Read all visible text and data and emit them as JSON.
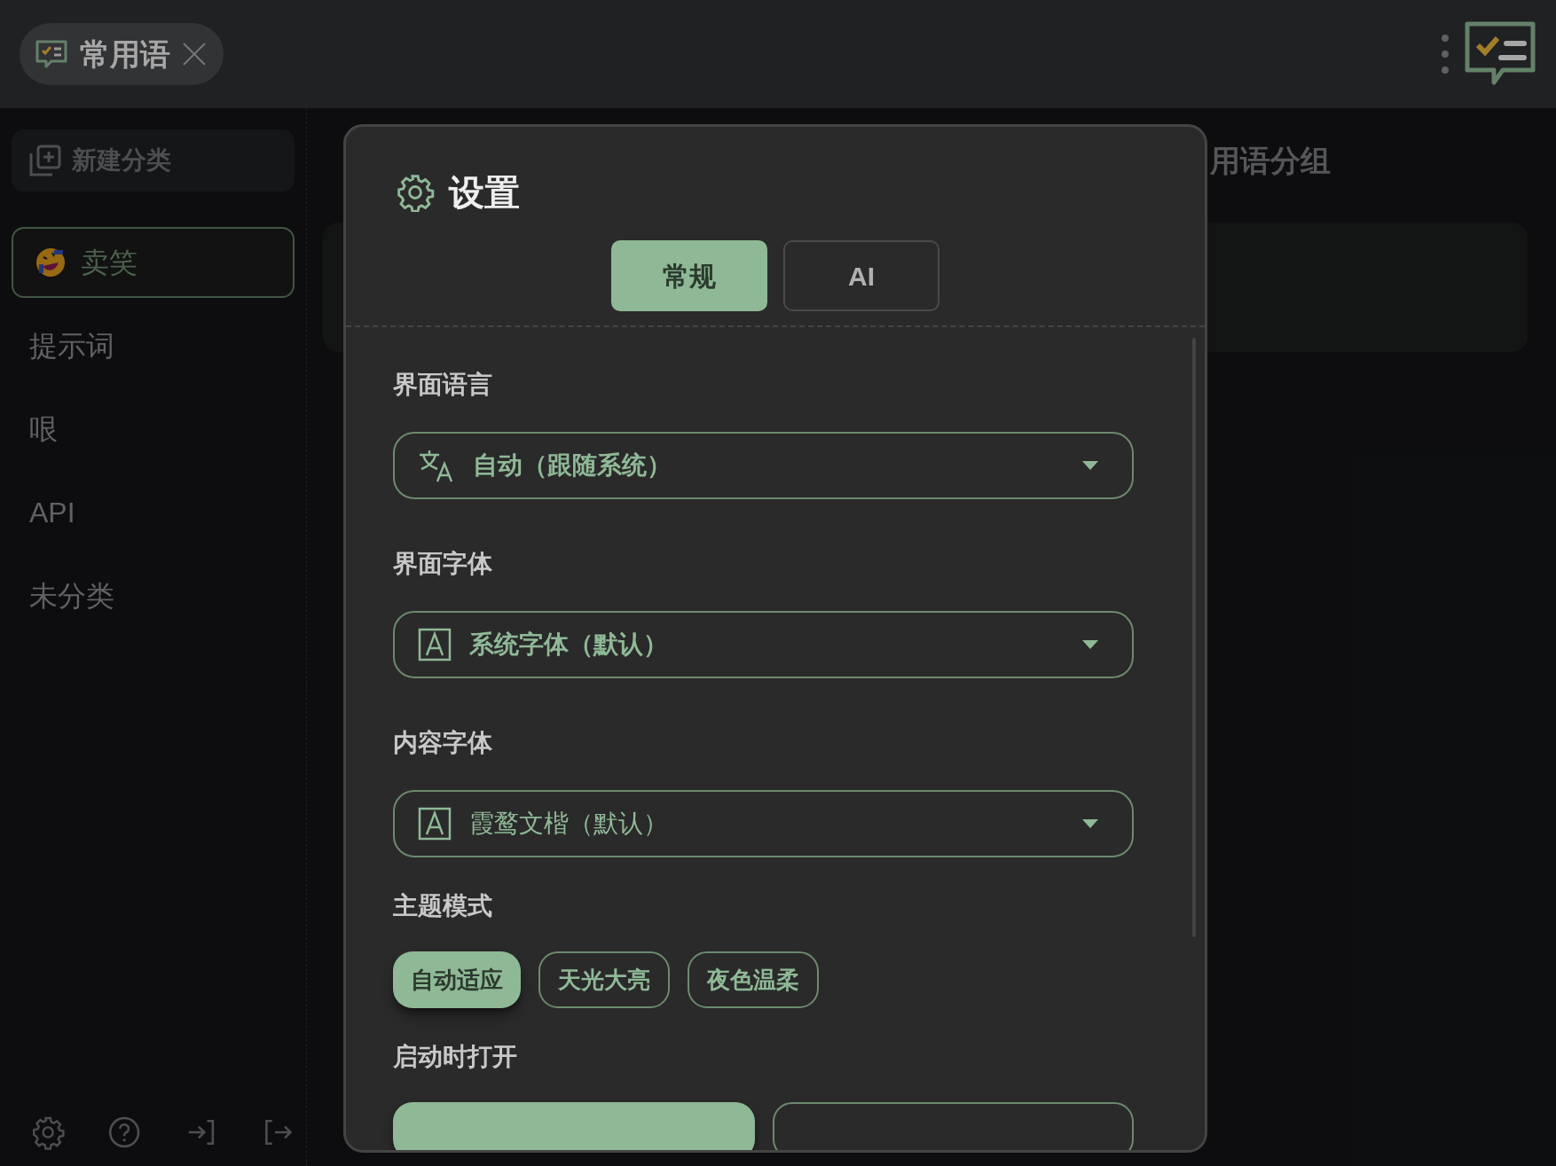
{
  "app_tab": {
    "title": "常用语"
  },
  "sidebar": {
    "new_button": "新建分类",
    "items": [
      {
        "label": "卖笑",
        "selected": true,
        "emoji": true
      },
      {
        "label": "提示词",
        "selected": false
      },
      {
        "label": "哏",
        "selected": false
      },
      {
        "label": "API",
        "selected": false
      },
      {
        "label": "未分类",
        "selected": false
      }
    ]
  },
  "main": {
    "heading": "用语分组"
  },
  "settings": {
    "title": "设置",
    "tabs": [
      {
        "label": "常规",
        "selected": true
      },
      {
        "label": "AI",
        "selected": false
      }
    ],
    "fields": [
      {
        "label": "界面语言",
        "value": "自动（跟随系统）",
        "kind": "language",
        "bold": true
      },
      {
        "label": "界面字体",
        "value": "系统字体（默认）",
        "kind": "font",
        "bold": true
      },
      {
        "label": "内容字体",
        "value": "霞鹜文楷（默认）",
        "kind": "font",
        "bold": false
      }
    ],
    "theme": {
      "label": "主题模式",
      "options": [
        {
          "label": "自动适应",
          "selected": true
        },
        {
          "label": "天光大亮",
          "selected": false
        },
        {
          "label": "夜色温柔",
          "selected": false
        }
      ]
    },
    "startup": {
      "label": "启动时打开",
      "options": [
        {
          "selected": true
        },
        {
          "selected": false
        }
      ]
    }
  }
}
